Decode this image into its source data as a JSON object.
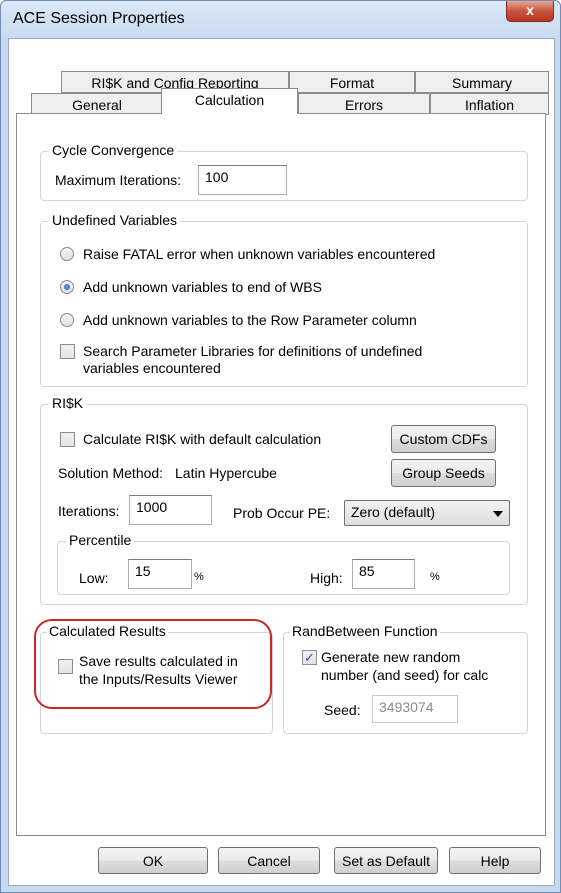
{
  "window": {
    "title": "ACE Session Properties",
    "close_glyph": "x"
  },
  "tabs_row1": [
    {
      "label": "RI$K and Config Reporting"
    },
    {
      "label": "Format"
    },
    {
      "label": "Summary"
    }
  ],
  "tabs_row2": [
    {
      "label": "General"
    },
    {
      "label": "Calculation"
    },
    {
      "label": "Errors"
    },
    {
      "label": "Inflation"
    }
  ],
  "active_tab": "Calculation",
  "cycle_convergence": {
    "title": "Cycle Convergence",
    "max_iterations_label": "Maximum Iterations:",
    "max_iterations_value": "100"
  },
  "undefined_variables": {
    "title": "Undefined Variables",
    "option1": "Raise FATAL error when unknown variables encountered",
    "option2": "Add unknown variables to end of WBS",
    "option3": "Add unknown variables to the Row Parameter column",
    "search_line1": "Search Parameter Libraries for definitions of undefined",
    "search_line2": "variables encountered",
    "selected_option": 2
  },
  "risk": {
    "title": "RI$K",
    "calc_default_label": "Calculate RI$K with default calculation",
    "custom_cdfs": "Custom CDFs",
    "group_seeds": "Group Seeds",
    "solution_method_label": "Solution Method:",
    "solution_method_value": "Latin Hypercube",
    "iterations_label": "Iterations:",
    "iterations_value": "1000",
    "prob_occur_label": "Prob Occur PE:",
    "prob_occur_value": "Zero (default)",
    "percentile": {
      "title": "Percentile",
      "low_label": "Low:",
      "low_value": "15",
      "low_unit": "%",
      "high_label": "High:",
      "high_value": "85",
      "high_unit": "%"
    }
  },
  "calculated_results": {
    "title": "Calculated Results",
    "save_line1": "Save results calculated in",
    "save_line2": "the Inputs/Results Viewer",
    "checked": false
  },
  "randbetween": {
    "title": "RandBetween Function",
    "generate_line1": "Generate new random",
    "generate_line2": "number (and seed) for calc",
    "checked": true,
    "check_glyph": "✓",
    "seed_label": "Seed:",
    "seed_value": "3493074"
  },
  "footer": {
    "ok": "OK",
    "cancel": "Cancel",
    "set_default": "Set as Default",
    "help": "Help"
  },
  "colors": {
    "highlight_circle": "#c62828",
    "close_button": "#c9553d"
  }
}
